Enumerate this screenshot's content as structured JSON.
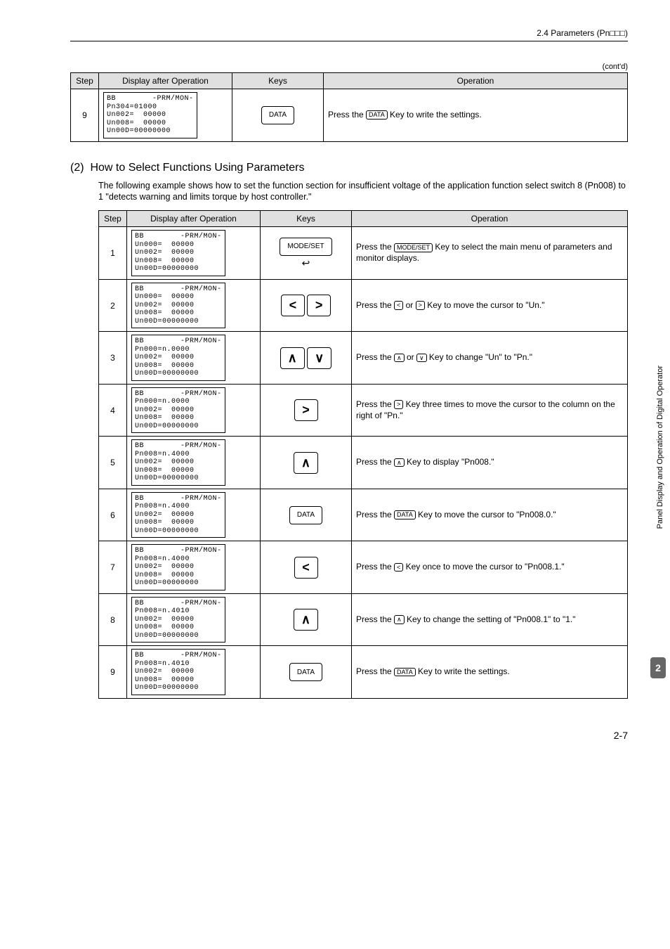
{
  "header_right": "2.4  Parameters (Pn□□□)",
  "contd": "(cont'd)",
  "table1": {
    "headers": [
      "Step",
      "Display after Operation",
      "Keys",
      "Operation"
    ],
    "rows": [
      {
        "step": "9",
        "lcd": "BB        -PRM/MON-\nPn304=01000\nUn002=  00000\nUn008=  00000\nUn00D=00000000",
        "key_label": "DATA",
        "op_prefix": "Press the ",
        "op_key": "DATA",
        "op_suffix": " Key to write the settings."
      }
    ]
  },
  "section": {
    "num": "(2)",
    "title": "How to Select Functions Using Parameters",
    "body": "The following example shows how to set the function section for insufficient voltage of the application function select switch 8 (Pn008) to 1 \"detects warning and limits torque by host controller.\""
  },
  "table2": {
    "headers": [
      "Step",
      "Display after Operation",
      "Keys",
      "Operation"
    ],
    "rows": [
      {
        "step": "1",
        "lcd": "BB        -PRM/MON-\nUn000=  00000\nUn002=  00000\nUn008=  00000\nUn00D=00000000",
        "keys": [
          {
            "label": "MODE/SET"
          }
        ],
        "extra_icon": true,
        "op": "Press the [MODE/SET] Key to select the main menu of parameters and monitor displays.",
        "op_key": "MODE/SET"
      },
      {
        "step": "2",
        "lcd": "BB        -PRM/MON-\nUn000=  00000\nUn002=  00000\nUn008=  00000\nUn00D=00000000",
        "keys": [
          {
            "arrow": "<"
          },
          {
            "arrow": ">"
          }
        ],
        "op": "Press the [<] or [>] Key to move the cursor to \"Un.\"",
        "op_arrows": [
          "<",
          ">"
        ]
      },
      {
        "step": "3",
        "lcd": "BB        -PRM/MON-\nPn000=n.0000\nUn002=  00000\nUn008=  00000\nUn00D=00000000",
        "keys": [
          {
            "arrow": "∧"
          },
          {
            "arrow": "∨"
          }
        ],
        "op": "Press the [∧] or [∨] Key to change \"Un\" to \"Pn.\"",
        "op_arrows": [
          "∧",
          "∨"
        ]
      },
      {
        "step": "4",
        "lcd": "BB        -PRM/MON-\nPn000=n.0000\nUn002=  00000\nUn008=  00000\nUn00D=00000000",
        "keys": [
          {
            "arrow": ">"
          }
        ],
        "op": "Press the [>] Key three times to move the cursor to the column on the right of \"Pn.\"",
        "op_arrows": [
          ">"
        ]
      },
      {
        "step": "5",
        "lcd": "BB        -PRM/MON-\nPn008=n.4000\nUn002=  00000\nUn008=  00000\nUn00D=00000000",
        "keys": [
          {
            "arrow": "∧"
          }
        ],
        "op": "Press the [∧] Key to display \"Pn008.\"",
        "op_arrows": [
          "∧"
        ]
      },
      {
        "step": "6",
        "lcd": "BB        -PRM/MON-\nPn008=n.4000\nUn002=  00000\nUn008=  00000\nUn00D=00000000",
        "keys": [
          {
            "label": "DATA"
          }
        ],
        "op": "Press the [DATA] Key to move the cursor to \"Pn008.0.\"",
        "op_key": "DATA"
      },
      {
        "step": "7",
        "lcd": "BB        -PRM/MON-\nPn008=n.4000\nUn002=  00000\nUn008=  00000\nUn00D=00000000",
        "keys": [
          {
            "arrow": "<"
          }
        ],
        "op": "Press the [<] Key once to move the cursor to \"Pn008.1.\"",
        "op_arrows": [
          "<"
        ]
      },
      {
        "step": "8",
        "lcd": "BB        -PRM/MON-\nPn008=n.4010\nUn002=  00000\nUn008=  00000\nUn00D=00000000",
        "keys": [
          {
            "arrow": "∧"
          }
        ],
        "op": "Press the [∧] Key to change the setting of \"Pn008.1\" to \"1.\"",
        "op_arrows": [
          "∧"
        ]
      },
      {
        "step": "9",
        "lcd": "BB        -PRM/MON-\nPn008=n.4010\nUn002=  00000\nUn008=  00000\nUn00D=00000000",
        "keys": [
          {
            "label": "DATA"
          }
        ],
        "op": "Press the [DATA] Key to write the settings.",
        "op_key": "DATA"
      }
    ]
  },
  "sidetab": "Panel Display and Operation of Digital Operator",
  "sidebadge": "2",
  "pgnum": "2-7"
}
